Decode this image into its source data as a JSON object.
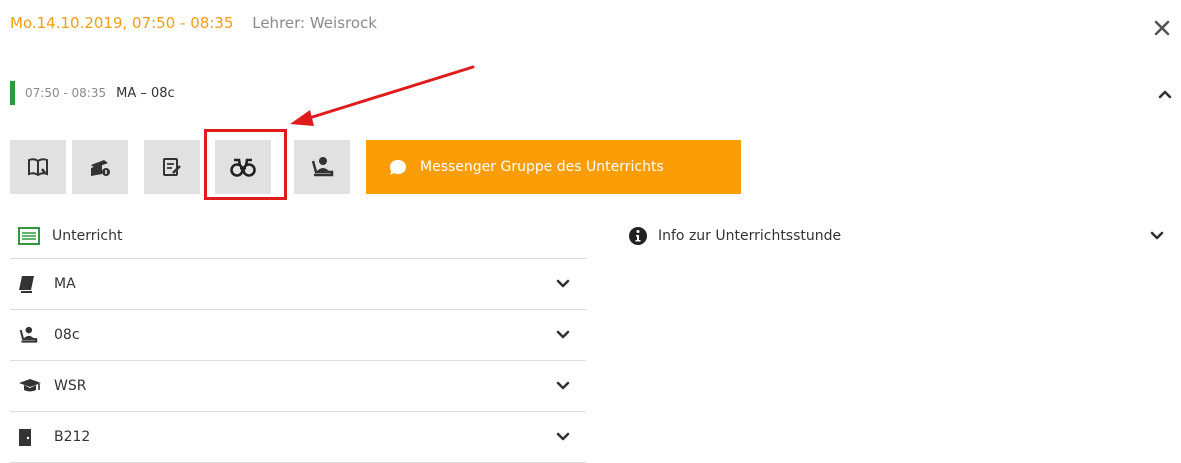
{
  "header": {
    "datetime": "Mo.14.10.2019, 07:50 - 08:35",
    "teacher": "Lehrer: Weisrock"
  },
  "lesson": {
    "time": "07:50 - 08:35",
    "title": "MA – 08c"
  },
  "toolbar": {
    "messenger_label": "Messenger Gruppe des Unterrichts"
  },
  "left_panel": {
    "heading": "Unterricht",
    "rows": [
      {
        "label": "MA"
      },
      {
        "label": "08c"
      },
      {
        "label": "WSR"
      },
      {
        "label": "B212"
      }
    ]
  },
  "info_panel": {
    "label": "Info zur Unterrichtsstunde"
  },
  "colors": {
    "accent_orange": "#fb9d05",
    "header_orange": "#f39c12",
    "status_green": "#2e9a3e",
    "highlight_red": "#e01b1b"
  }
}
